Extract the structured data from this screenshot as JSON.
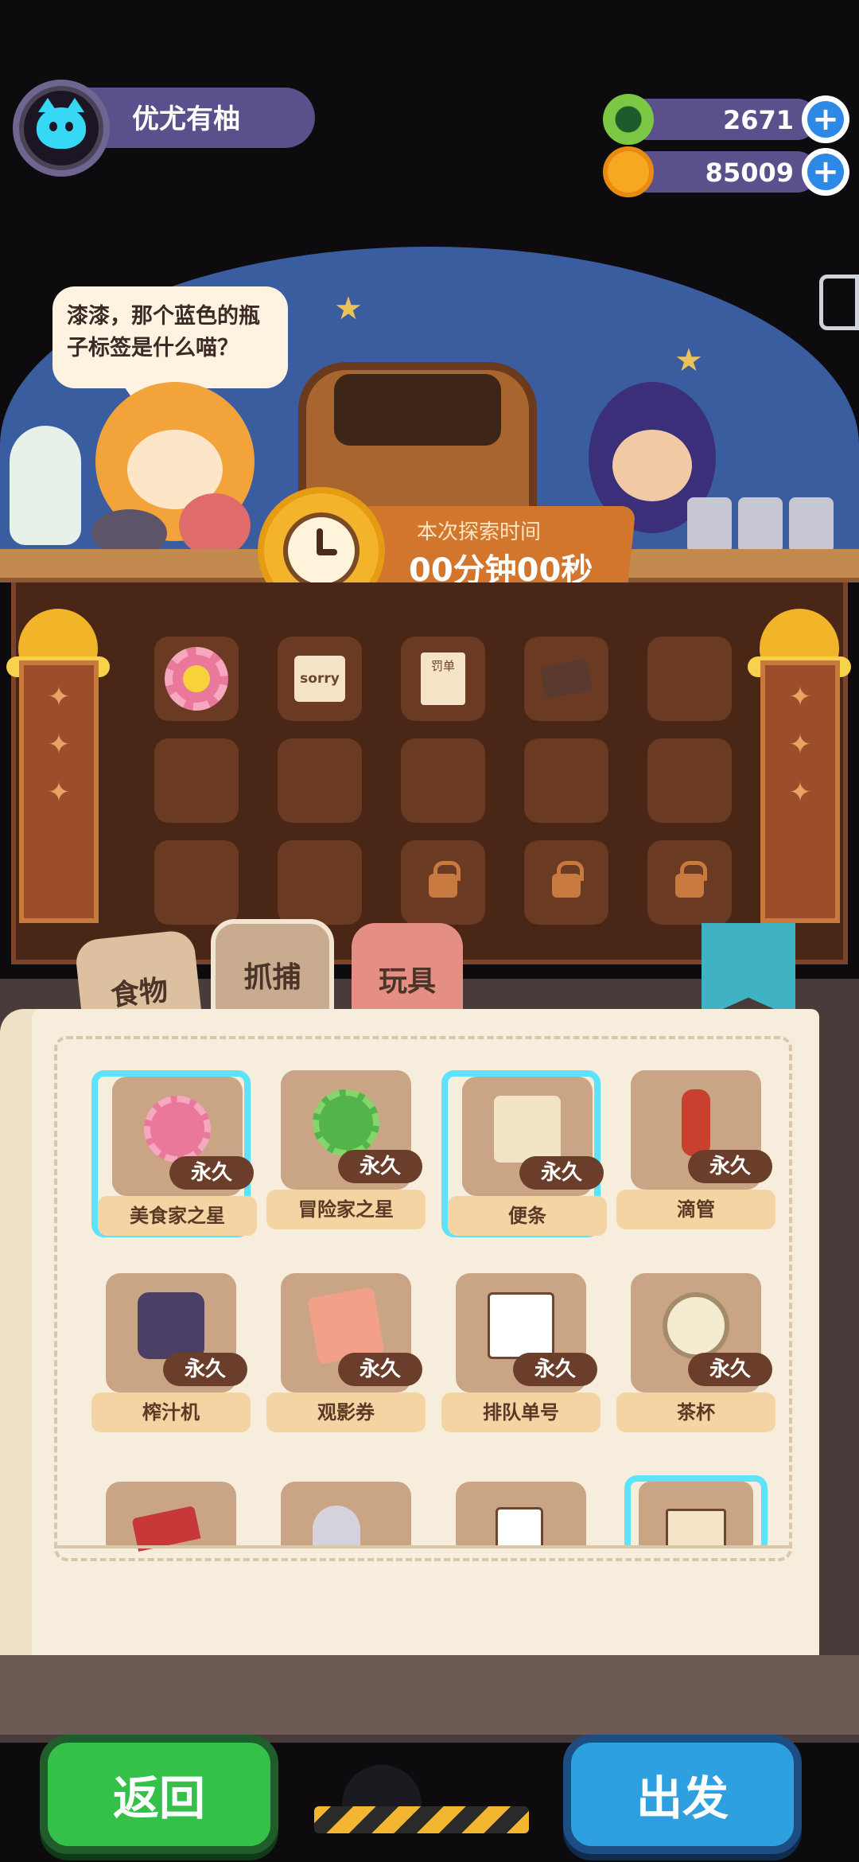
{
  "player": {
    "name": "优尤有柚"
  },
  "currency": {
    "gems": "2671",
    "coins": "85009"
  },
  "speech": {
    "text": "漆漆，那个蓝色的瓶子标签是什么喵？"
  },
  "timer": {
    "label": "本次探索时间",
    "value": "00分钟00秒"
  },
  "inventory": {
    "items": [
      {
        "name": "sunflower",
        "icon_color": "#e9789a"
      },
      {
        "name": "sorry-note",
        "label": "sorry"
      },
      {
        "name": "fine-ticket",
        "label": "罚单"
      },
      {
        "name": "home-sign"
      },
      {
        "name": "empty"
      }
    ]
  },
  "tabs": [
    {
      "label": "食物"
    },
    {
      "label": "抓捕"
    },
    {
      "label": "玩具"
    }
  ],
  "book": {
    "permanent_label": "永久",
    "items": [
      {
        "name": "美食家之星",
        "icon_color": "#e9789a"
      },
      {
        "name": "冒险家之星",
        "icon_color": "#52b44a"
      },
      {
        "name": "便条",
        "icon_color": "#f1e3c6"
      },
      {
        "name": "滴管",
        "icon_color": "#c8412f"
      },
      {
        "name": "榨汁机",
        "icon_color": "#4b3f66"
      },
      {
        "name": "观影券",
        "icon_color": "#f2a08a"
      },
      {
        "name": "排队单号",
        "icon_color": "#ffffff"
      },
      {
        "name": "茶杯",
        "icon_color": "#f3ecd0"
      }
    ]
  },
  "buttons": {
    "back": "返回",
    "go": "出发"
  }
}
